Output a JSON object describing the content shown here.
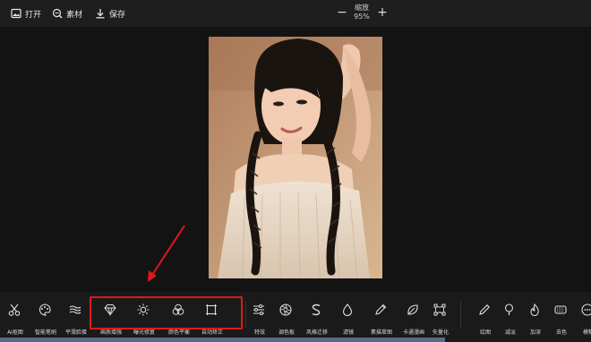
{
  "topbar": {
    "open_label": "打开",
    "material_label": "素材",
    "save_label": "保存",
    "zoom_label": "缩放",
    "zoom_value": "95%",
    "zoom_minus": "−",
    "zoom_plus": "+"
  },
  "tools": [
    {
      "label": "AI抠图",
      "icon": "scissors-icon"
    },
    {
      "label": "智能笔刷",
      "icon": "palette-icon"
    },
    {
      "label": "平滑脸蛋",
      "icon": "waves-icon"
    },
    {
      "label": "画质增强",
      "icon": "diamond-icon"
    },
    {
      "label": "曝光修复",
      "icon": "sun-icon"
    },
    {
      "label": "颜色平衡",
      "icon": "rgb-circles-icon"
    },
    {
      "label": "自动矫正",
      "icon": "crop-frame-icon"
    },
    {
      "label": "特效",
      "icon": "sliders-icon"
    },
    {
      "label": "调色板",
      "icon": "aperture-icon"
    },
    {
      "label": "风格迁移",
      "icon": "style-s-icon"
    },
    {
      "label": "滤镜",
      "icon": "drop-icon"
    },
    {
      "label": "素描草图",
      "icon": "pen-icon"
    },
    {
      "label": "卡通漫画",
      "icon": "leaf-icon"
    },
    {
      "label": "矢量化",
      "icon": "vector-nodes-icon"
    },
    {
      "label": "绘图",
      "icon": "pencil-icon"
    },
    {
      "label": "减淡",
      "icon": "dodge-icon"
    },
    {
      "label": "加深",
      "icon": "flame-icon"
    },
    {
      "label": "去色",
      "icon": "desaturate-icon"
    },
    {
      "label": "模糊",
      "icon": "blur-icon"
    }
  ],
  "colors": {
    "highlight": "#e01818",
    "progress": "#5a6b86"
  }
}
